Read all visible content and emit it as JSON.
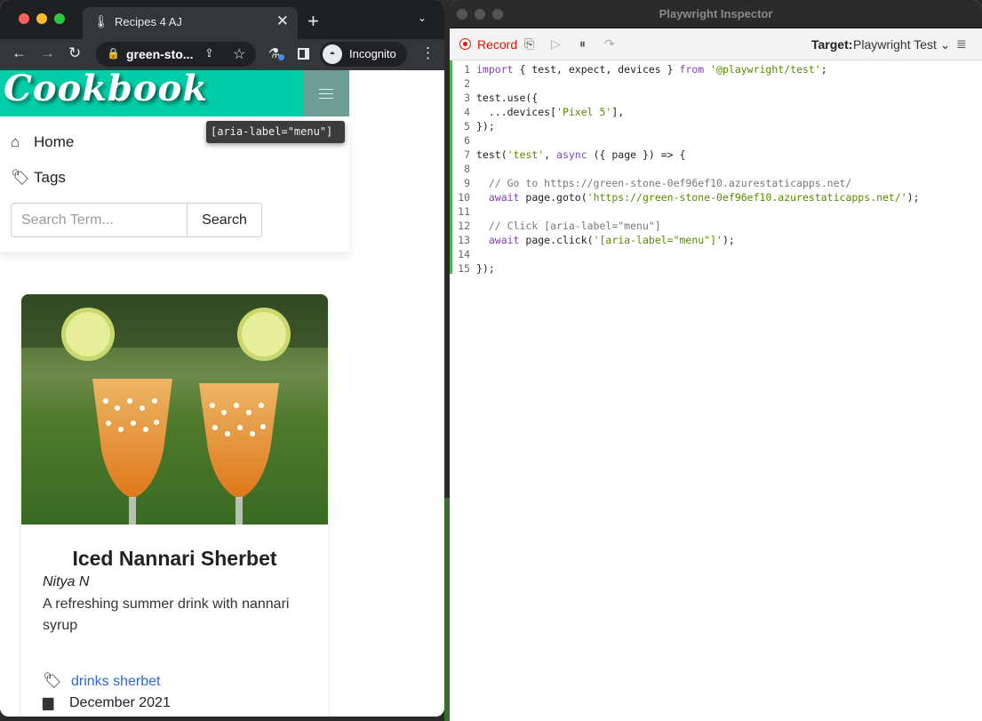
{
  "browser": {
    "tab_title": "Recipes 4 AJ",
    "url": "green-sto...",
    "incognito_label": "Incognito"
  },
  "page": {
    "brand": "Cookbook",
    "tooltip": "[aria-label=\"menu\"]",
    "menu": {
      "home_label": "Home",
      "tags_label": "Tags",
      "search_placeholder": "Search Term...",
      "search_button": "Search"
    },
    "recipe": {
      "title": "Iced Nannari Sherbet",
      "author": "Nitya N",
      "description": "A refreshing summer drink with nannari syrup",
      "tags": "drinks sherbet",
      "date": "December 2021"
    }
  },
  "inspector": {
    "window_title": "Playwright Inspector",
    "record_label": "Record",
    "target_label": "Target:",
    "target_value": "Playwright Test",
    "code": [
      {
        "num": "1",
        "html": "<span class=\"kw\">import</span> { test, expect, devices } <span class=\"kw\">from</span> <span class=\"st\">'@playwright/test'</span>;"
      },
      {
        "num": "2",
        "html": ""
      },
      {
        "num": "3",
        "html": "test.use({"
      },
      {
        "num": "4",
        "html": "  ...devices[<span class=\"st\">'Pixel 5'</span>],"
      },
      {
        "num": "5",
        "html": "});"
      },
      {
        "num": "6",
        "html": ""
      },
      {
        "num": "7",
        "html": "test(<span class=\"st\">'test'</span>, <span class=\"kw\">async</span> ({ page }) => {"
      },
      {
        "num": "8",
        "html": ""
      },
      {
        "num": "9",
        "html": "  <span class=\"cm\">// Go to https://green-stone-0ef96ef10.azurestaticapps.net/</span>"
      },
      {
        "num": "10",
        "html": "  <span class=\"kw\">await</span> page.goto(<span class=\"st\">'https://green-stone-0ef96ef10.azurestaticapps.net/'</span>);"
      },
      {
        "num": "11",
        "html": ""
      },
      {
        "num": "12",
        "html": "  <span class=\"cm\">// Click [aria-label=\"menu\"]</span>"
      },
      {
        "num": "13",
        "html": "  <span class=\"kw\">await</span> page.click(<span class=\"st\">'[aria-label=\"menu\"]'</span>);"
      },
      {
        "num": "14",
        "html": ""
      },
      {
        "num": "15",
        "html": "});"
      }
    ]
  },
  "colors": {
    "navbar": "#00cea8",
    "record": "#e51400",
    "link": "#2a6ad3"
  }
}
